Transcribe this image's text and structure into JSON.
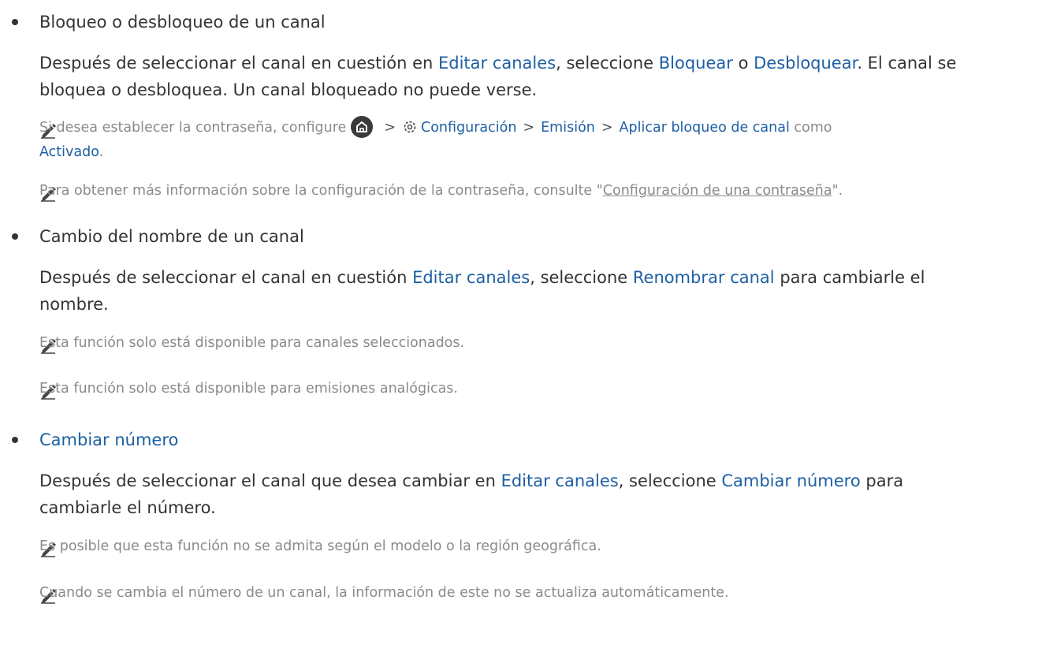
{
  "items": [
    {
      "title": "Bloqueo o desbloqueo de un canal",
      "p1": "Después de seleccionar el canal en cuestión en ",
      "p1_link1": "Editar canales",
      "p1_mid": ", seleccione ",
      "p1_link2": "Bloquear",
      "p1_o": " o ",
      "p1_link3": "Desbloquear",
      "p1_end": ". El canal se",
      "p2": "bloquea o desbloquea. Un canal bloqueado no puede verse.",
      "note1": {
        "pre": "Si desea establecer la contraseña, configure",
        "crumb1": "Configuración",
        "crumb2": "Emisión",
        "crumb3": "Aplicar bloqueo de canal",
        "post": " como",
        "line2_link": "Activado",
        "line2_end": "."
      },
      "note2": {
        "pre": "Para obtener más información sobre la configuración de la contraseña, consulte \"",
        "link": "Configuración de una contraseña",
        "post": "\"."
      }
    },
    {
      "title": "Cambio del nombre de un canal",
      "p1": "Después de seleccionar el canal en cuestión ",
      "p1_link1": "Editar canales",
      "p1_mid": ", seleccione ",
      "p1_link2": "Renombrar canal",
      "p1_end": " para cambiarle el",
      "p2": "nombre.",
      "note1": "Esta función solo está disponible para canales seleccionados.",
      "note2": "Esta función solo está disponible para emisiones analógicas."
    },
    {
      "title": "Cambiar número",
      "p1": "Después de seleccionar el canal que desea cambiar en ",
      "p1_link1": "Editar canales",
      "p1_mid": ", seleccione ",
      "p1_link2": "Cambiar número",
      "p1_end": " para",
      "p2": "cambiarle el número.",
      "note1": "Es posible que esta función no se admita según el modelo o la región geográfica.",
      "note2": "Cuando se cambia el número de un canal, la información de este no se actualiza automáticamente."
    }
  ],
  "icons": [
    "pencil-note-icon",
    "home-icon",
    "chevron-right-icon",
    "gear-icon"
  ],
  "colors": {
    "link": "#1d5fa3",
    "note_text": "#8a8a8a",
    "body_text": "#333333"
  }
}
